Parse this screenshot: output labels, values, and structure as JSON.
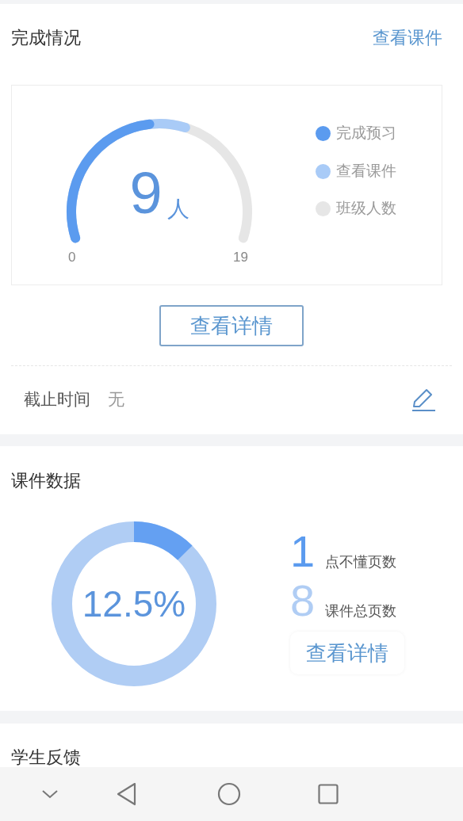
{
  "completion": {
    "title": "完成情况",
    "link": "查看课件",
    "gauge": {
      "value": "9",
      "unit": "人",
      "min": "0",
      "max": "19"
    },
    "legend": [
      {
        "label": "完成预习",
        "color": "#5b9bef"
      },
      {
        "label": "查看课件",
        "color": "#a9cbf7"
      },
      {
        "label": "班级人数",
        "color": "#e6e6e6"
      }
    ],
    "details_button": "查看详情",
    "deadline_label": "截止时间",
    "deadline_value": "无"
  },
  "courseware": {
    "title": "课件数据",
    "percent": "12.5%",
    "stats": [
      {
        "number": "1",
        "label": "点不懂页数",
        "color": "#5b9bef"
      },
      {
        "number": "8",
        "label": "课件总页数",
        "color": "#b0cdf4"
      }
    ],
    "details_button": "查看详情"
  },
  "feedback": {
    "title": "学生反馈"
  }
}
